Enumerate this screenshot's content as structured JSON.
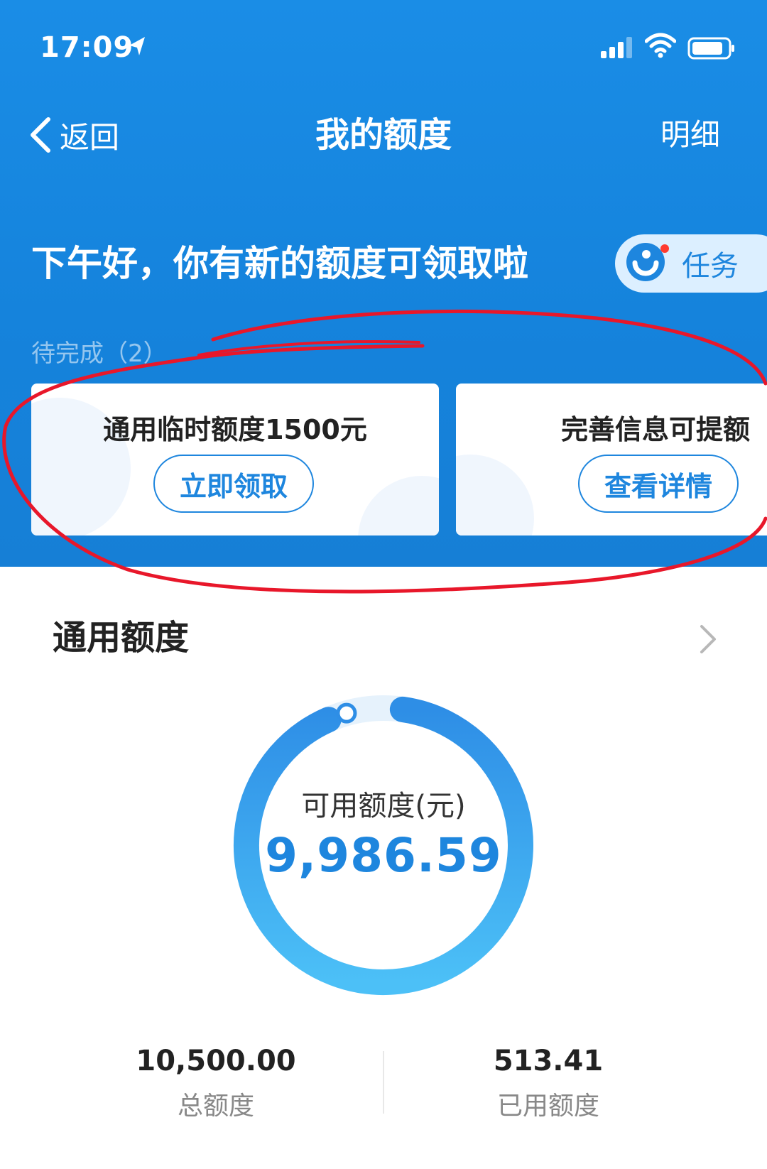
{
  "status_bar": {
    "time": "17:09",
    "icons": [
      "location-arrow-icon",
      "signal-icon",
      "wifi-icon",
      "battery-icon"
    ]
  },
  "nav": {
    "back_label": "返回",
    "title": "我的额度",
    "detail_label": "明细"
  },
  "greeting": "下午好，你有新的额度可领取啦",
  "task": {
    "label": "任务",
    "icon": "task-icon",
    "has_notification": true
  },
  "pending_label": "待完成（2）",
  "cards": [
    {
      "title": "通用临时额度1500元",
      "button": "立即领取"
    },
    {
      "title": "完善信息可提额",
      "button": "查看详情"
    }
  ],
  "section": {
    "title": "通用额度"
  },
  "ring": {
    "label": "可用额度(元)",
    "value": "9,986.59",
    "available_fraction": 0.951
  },
  "stats": [
    {
      "value": "10,500.00",
      "label": "总额度"
    },
    {
      "value": "513.41",
      "label": "已用额度"
    }
  ],
  "colors": {
    "header_blue": "#1583dc",
    "accent_blue": "#1e86de",
    "annotation_red": "#e8172a"
  }
}
